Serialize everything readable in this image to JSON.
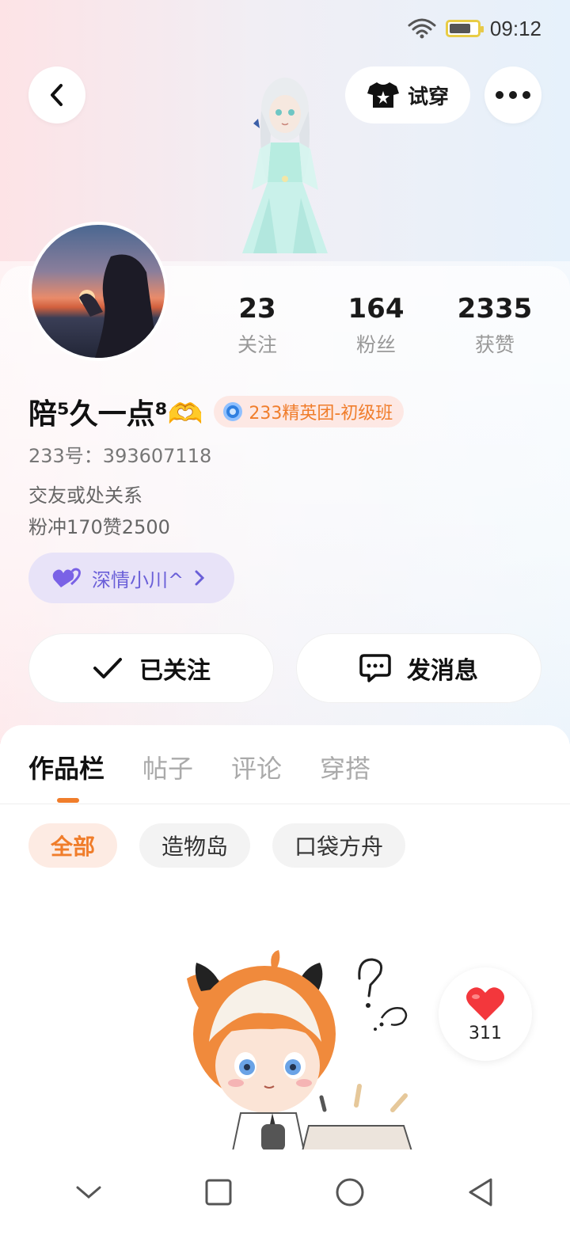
{
  "status_bar": {
    "time": "09:12"
  },
  "header": {
    "tryon_label": "试穿"
  },
  "stats": [
    {
      "value": "23",
      "label": "关注"
    },
    {
      "value": "164",
      "label": "粉丝"
    },
    {
      "value": "2335",
      "label": "获赞"
    }
  ],
  "profile": {
    "username": "陪⁵久一点⁸🫶",
    "badge": "233精英团-初级班",
    "uid": "233号：393607118",
    "bio_line1": "交友或处关系",
    "bio_line2": "粉冲170赞2500",
    "friend_chip": "深情小川^"
  },
  "actions": {
    "follow_label": "已关注",
    "message_label": "发消息"
  },
  "tabs": [
    "作品栏",
    "帖子",
    "评论",
    "穿搭"
  ],
  "filters": [
    "全部",
    "造物岛",
    "口袋方舟"
  ],
  "like": {
    "count": "311"
  },
  "colors": {
    "accent": "#f07d2b",
    "friend": "#6a5fd8"
  }
}
